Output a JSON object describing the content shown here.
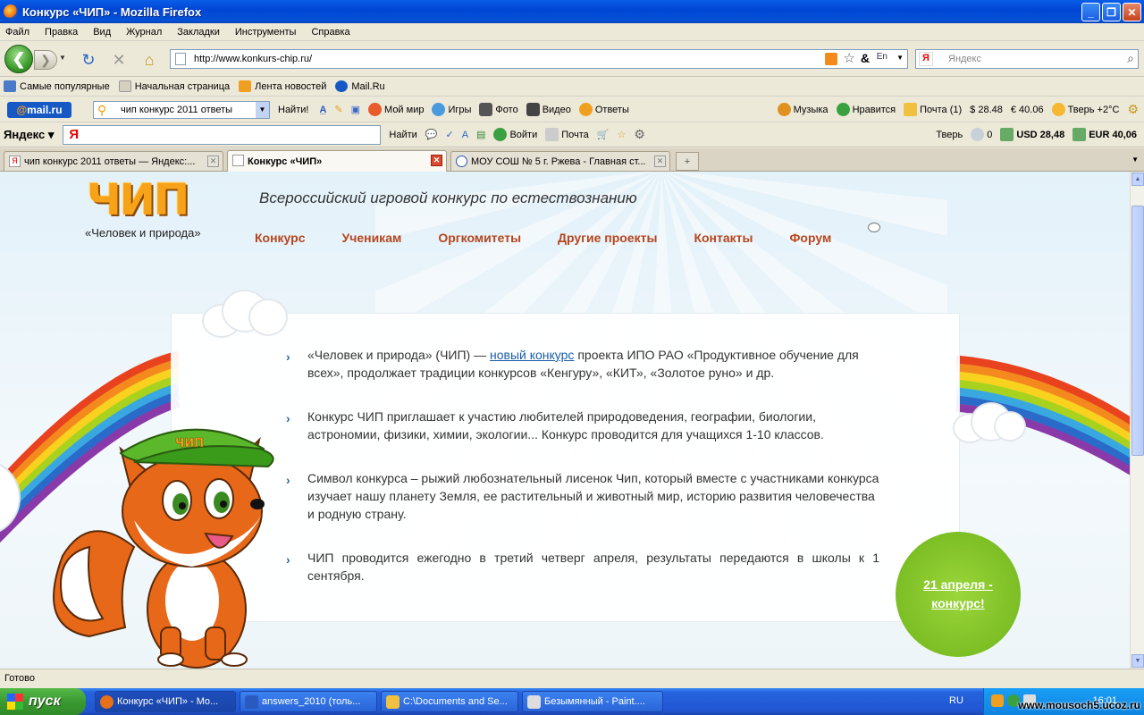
{
  "window": {
    "title": "Конкурс «ЧИП» - Mozilla Firefox"
  },
  "menu": [
    "Файл",
    "Правка",
    "Вид",
    "Журнал",
    "Закладки",
    "Инструменты",
    "Справка"
  ],
  "nav": {
    "url": "http://www.konkurs-chip.ru/",
    "search_placeholder": "Яндекс"
  },
  "bookmarks": [
    {
      "label": "Самые популярные",
      "color": "#4a7ac8"
    },
    {
      "label": "Начальная страница",
      "color": "#d6d0c0"
    },
    {
      "label": "Лента новостей",
      "color": "#f0a020"
    },
    {
      "label": "Mail.Ru",
      "color": "#1659c4"
    }
  ],
  "mailbar": {
    "search_value": "чип конкурс 2011 ответы",
    "find_label": "Найти!",
    "items": [
      {
        "label": "Мой мир",
        "color": "#e85a2a"
      },
      {
        "label": "Игры",
        "color": "#4a9ae0"
      },
      {
        "label": "Фото",
        "color": "#555"
      },
      {
        "label": "Видео",
        "color": "#444"
      },
      {
        "label": "Ответы",
        "color": "#f0a020"
      }
    ],
    "right": [
      {
        "label": "Музыка",
        "color": "#e09020"
      },
      {
        "label": "Нравится",
        "color": "#3aa040"
      },
      {
        "label": "Почта (1)",
        "color": "#f0c040"
      },
      {
        "label": "$ 28.48",
        "color": "transparent"
      },
      {
        "label": "€ 40.06",
        "color": "transparent"
      },
      {
        "label": "Тверь +2°C",
        "color": "#f5b830"
      }
    ]
  },
  "yabar": {
    "logo": "Яндекс",
    "find_label": "Найти",
    "login_label": "Войти",
    "mail_label": "Почта",
    "city": "Тверь",
    "weather": "0",
    "usd": "USD 28,48",
    "eur": "EUR 40,06"
  },
  "tabs": [
    {
      "label": "чип конкурс 2011 ответы — Яндекс:...",
      "active": false
    },
    {
      "label": "Конкурс «ЧИП»",
      "active": true
    },
    {
      "label": "МОУ СОШ № 5 г. Ржева - Главная ст...",
      "active": false
    }
  ],
  "page": {
    "logo": "ЧИП",
    "logo_sub": "«Человек и природа»",
    "headline": "Всероссийский игровой конкурс по естествознанию",
    "nav": [
      "Конкурс",
      "Ученикам",
      "Оргкомитеты",
      "Другие проекты",
      "Контакты",
      "Форум"
    ],
    "items": [
      {
        "pre": "«Человек и природа» (ЧИП) — ",
        "link": "новый конкурс",
        "post": " проекта ИПО РАО «Продуктивное обучение для всех», продолжает традиции конкурсов «Кенгуру», «КИТ», «Золотое руно» и др."
      },
      {
        "pre": "Конкурс ЧИП приглашает к участию любителей природоведения, географии, биологии, астрономии, физики, химии, экологии... Конкурс проводится для учащихся 1-10 классов.",
        "link": "",
        "post": ""
      },
      {
        "pre": "Символ конкурса – рыжий любознательный лисенок Чип, который вместе с участниками конкурса изучает нашу планету Земля, ее растительный и животный мир, историю развития человечества и родную страну.",
        "link": "",
        "post": ""
      },
      {
        "pre": "ЧИП проводится ежегодно в третий четверг апреля, результаты передаются в школы к 1 сентября.",
        "link": "",
        "post": ""
      }
    ],
    "badge_line1": "21 апреля -",
    "badge_line2": "конкурс!",
    "cap_text": "ЧИП"
  },
  "status": "Готово",
  "taskbar": {
    "start": "пуск",
    "tasks": [
      {
        "label": "Конкурс «ЧИП» - Mo...",
        "color": "#e8701a",
        "active": true
      },
      {
        "label": "answers_2010 (толь...",
        "color": "#2a5abf",
        "active": false
      },
      {
        "label": "C:\\Documents and Se...",
        "color": "#f0c040",
        "active": false
      },
      {
        "label": "Безымянный - Paint....",
        "color": "#ddd",
        "active": false
      }
    ],
    "lang": "RU",
    "clock": "16:01",
    "watermark": "www.mousoch5.ucoz.ru"
  }
}
